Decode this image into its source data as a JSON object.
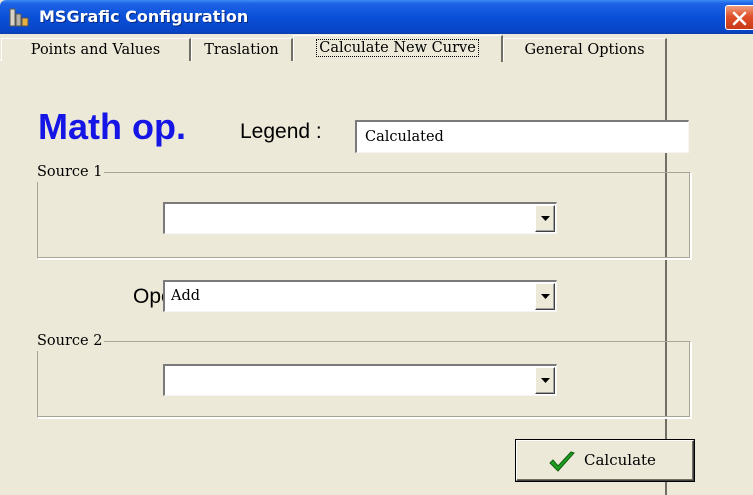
{
  "window": {
    "title": "MSGrafic Configuration"
  },
  "tabs": [
    {
      "label": "Points and Values",
      "active": false
    },
    {
      "label": "Traslation",
      "active": false
    },
    {
      "label": "Calculate New Curve",
      "active": true
    },
    {
      "label": "General Options",
      "active": false
    }
  ],
  "panel": {
    "heading": "Math op.",
    "legend_label": "Legend :",
    "legend_value": "Calculated",
    "source1": {
      "title": "Source 1",
      "value": ""
    },
    "operation_label": "Operation",
    "operation_value": "Add",
    "source2": {
      "title": "Source 2",
      "value": ""
    },
    "calculate_label": "Calculate"
  },
  "icons": {
    "app": "chart-app-icon",
    "close": "close-icon",
    "dropdown": "chevron-down-icon",
    "check": "check-icon"
  },
  "colors": {
    "titlebar": "#0a4fd8",
    "heading": "#1515e6",
    "face": "#ece9d8",
    "check": "#1e9e1e",
    "close": "#e0502a"
  }
}
